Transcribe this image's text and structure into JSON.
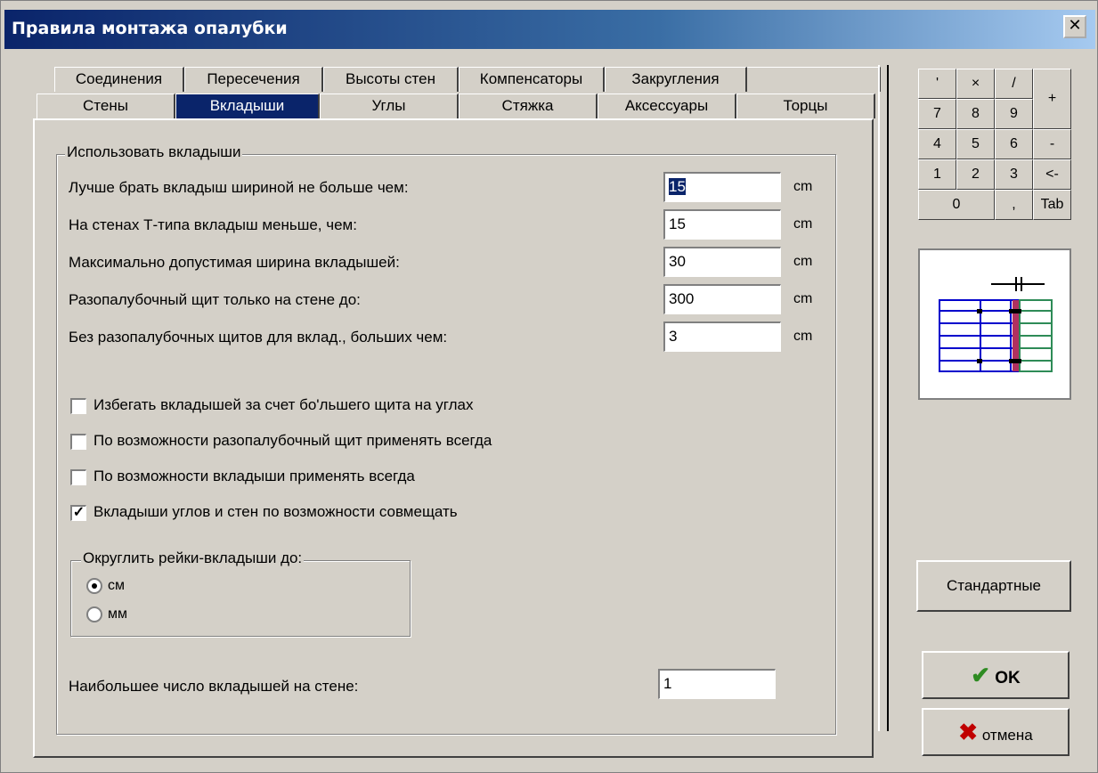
{
  "window": {
    "title": "Правила монтажа опалубки",
    "close_glyph": "✕"
  },
  "tabs_back": [
    "Соединения",
    "Пересечения",
    "Высоты стен",
    "Компенсаторы",
    "Закругления"
  ],
  "tabs_front": [
    "Стены",
    "Вкладыши",
    "Углы",
    "Стяжка",
    "Аксессуары",
    "Торцы"
  ],
  "active_tab": "Вкладыши",
  "group_main": {
    "legend": "Использовать вкладыши"
  },
  "fields": [
    {
      "label": "Лучше брать вкладыш шириной не больше чем:",
      "value": "15",
      "unit": "cm"
    },
    {
      "label": "На стенах Т-типа вкладыш меньше, чем:",
      "value": "15",
      "unit": "cm"
    },
    {
      "label": "Максимально допустимая ширина вкладышей:",
      "value": "30",
      "unit": "cm"
    },
    {
      "label": "Разопалубочный щит только на стене до:",
      "value": "300",
      "unit": "cm"
    },
    {
      "label": "Без разопалубочных щитов для вклад., больших чем:",
      "value": "3",
      "unit": "cm"
    }
  ],
  "checkboxes": [
    {
      "label": "Избегать вкладышей за счет бо'льшего щита на углах",
      "checked": false
    },
    {
      "label": "По возможности разопалубочный щит применять всегда",
      "checked": false
    },
    {
      "label": "По возможности вкладыши применять всегда",
      "checked": false
    },
    {
      "label": "Вкладыши углов и стен по возможности совмещать",
      "checked": true
    }
  ],
  "round_group": {
    "legend": "Округлить рейки-вкладыши до:",
    "options": [
      {
        "label": "см",
        "selected": true
      },
      {
        "label": "мм",
        "selected": false
      }
    ]
  },
  "max_inserts": {
    "label": "Наибольшее число вкладышей на стене:",
    "value": "1"
  },
  "keypad": {
    "row1": [
      "'",
      "×",
      "/"
    ],
    "plus": "+",
    "row2": [
      "7",
      "8",
      "9"
    ],
    "row3": [
      "4",
      "5",
      "6",
      "-"
    ],
    "row4": [
      "1",
      "2",
      "3",
      "<-"
    ],
    "row5": [
      "0",
      ",",
      "Tab"
    ]
  },
  "buttons": {
    "standard": "Стандартные",
    "ok": "OK",
    "cancel": "отмена"
  },
  "colors": {
    "titlebar": "#0a246a",
    "ok_check": "#2e8b22",
    "cancel_x": "#c00000",
    "preview_blue": "#0000cc",
    "preview_green": "#2e8b57",
    "preview_red": "#b03060"
  },
  "icons": {
    "ok": "check-icon",
    "cancel": "cross-icon",
    "close": "close-icon"
  }
}
